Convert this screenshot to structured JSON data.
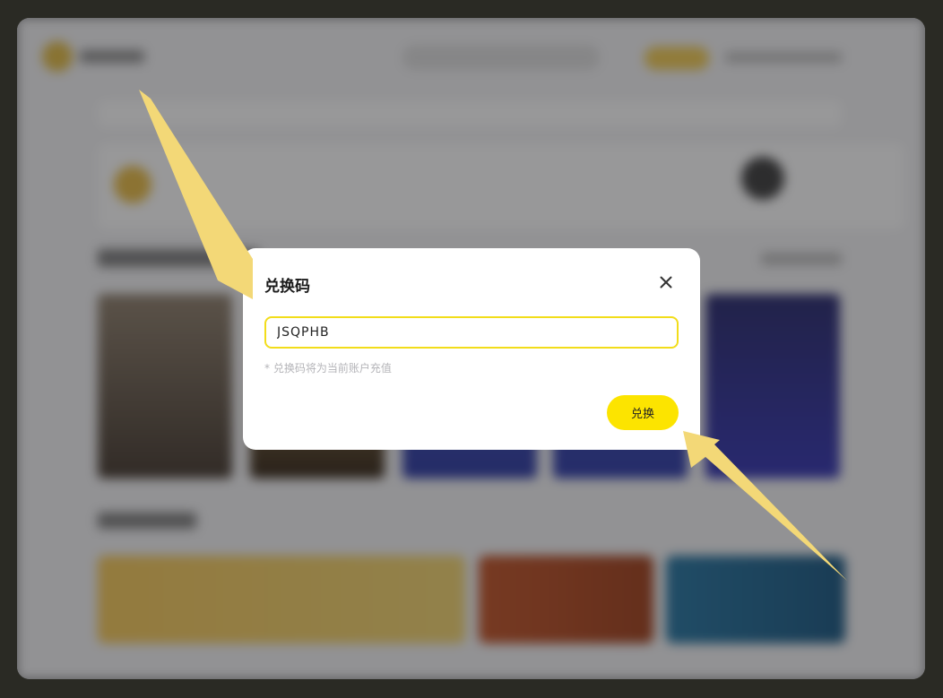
{
  "dialog": {
    "title": "兑换码",
    "close_icon": "close-icon",
    "input": {
      "value": "JSQPHB",
      "placeholder": ""
    },
    "hint": "* 兑换码将为当前账户充值",
    "redeem_label": "兑换"
  },
  "colors": {
    "accent": "#fce400",
    "input_border": "#f2dd1a",
    "annotation_arrow": "#f3d877",
    "backdrop": "#2a2a24"
  }
}
